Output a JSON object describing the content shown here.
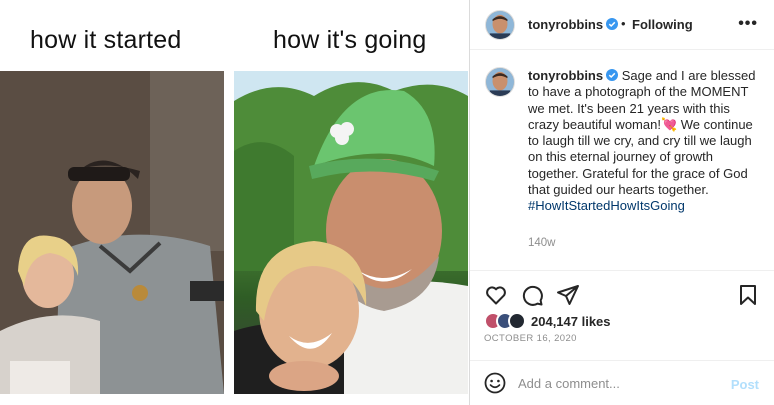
{
  "meme": {
    "left_caption": "how it started",
    "right_caption": "how it's going"
  },
  "header": {
    "username": "tonyrobbins",
    "dot": "•",
    "follow_state": "Following",
    "more_icon": "more-horizontal-icon"
  },
  "caption": {
    "username": "tonyrobbins",
    "text": "Sage and I are blessed to have a photograph of the MOMENT we met. It's been 21 years with this crazy beautiful woman!💘 We continue to laugh till we cry, and cry till we laugh on this eternal journey of growth together. Grateful for the grace of God that guided our hearts together.",
    "hashtag": "#HowItStartedHowItsGoing",
    "time_ago": "140w"
  },
  "actions": {
    "icons": [
      "heart-icon",
      "comment-icon",
      "share-icon",
      "bookmark-icon"
    ]
  },
  "likes": {
    "count": "204,147 likes",
    "date": "OCTOBER 16, 2020"
  },
  "comment_box": {
    "placeholder": "Add a comment...",
    "post_label": "Post"
  },
  "colors": {
    "verified": "#3897f0",
    "link": "#00376b",
    "post_disabled": "#b2dffc",
    "muted": "#8e8e8e"
  }
}
